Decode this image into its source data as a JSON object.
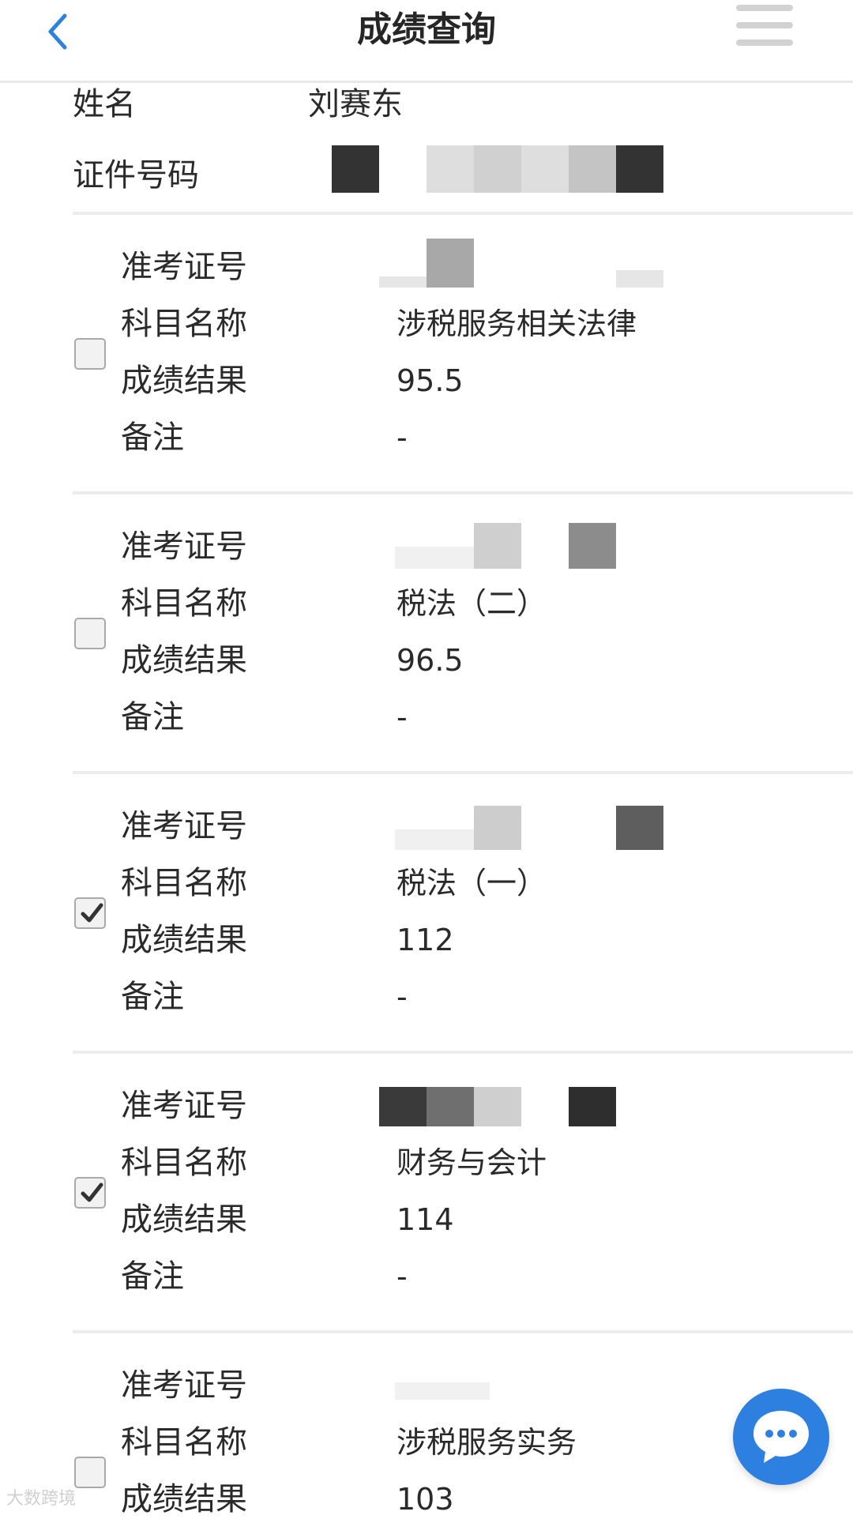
{
  "header": {
    "title": "成绩查询",
    "back_icon": "chevron-left-icon",
    "menu_icon": "hamburger-menu-icon",
    "accent_color": "#2d7fe0"
  },
  "person": {
    "name_label": "姓名",
    "name_value": "刘赛东",
    "id_label": "证件号码"
  },
  "labels": {
    "admission": "准考证号",
    "subject": "科目名称",
    "result": "成绩结果",
    "remark": "备注"
  },
  "records": [
    {
      "checked": false,
      "subject": "涉税服务相关法律",
      "score": "95.5",
      "remark": "-"
    },
    {
      "checked": false,
      "subject": "税法（二）",
      "score": "96.5",
      "remark": "-"
    },
    {
      "checked": true,
      "subject": "税法（一）",
      "score": "112",
      "remark": "-"
    },
    {
      "checked": true,
      "subject": "财务与会计",
      "score": "114",
      "remark": "-"
    },
    {
      "checked": false,
      "subject": "涉税服务实务",
      "score": "103"
    }
  ],
  "chat": {
    "icon": "chat-bubble-icon"
  },
  "watermark": {
    "text": "大数跨境"
  }
}
